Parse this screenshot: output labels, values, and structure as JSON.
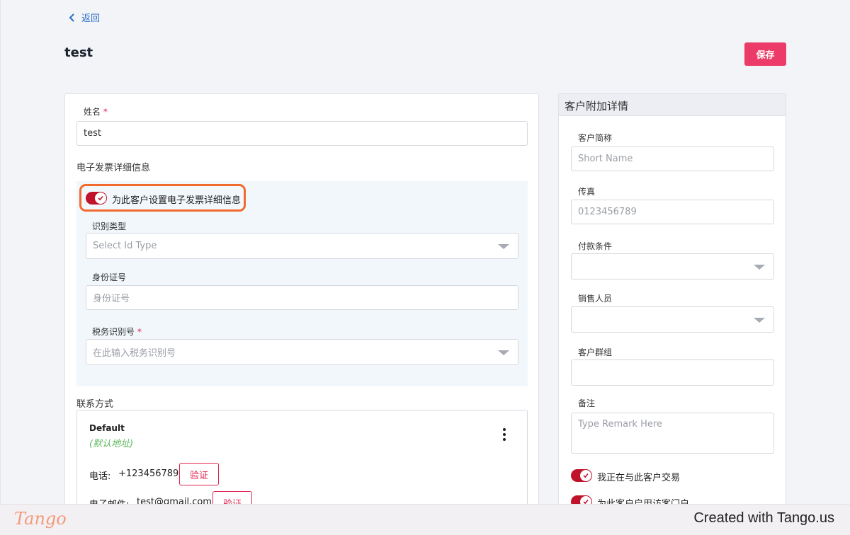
{
  "nav": {
    "back_label": "返回"
  },
  "page": {
    "title": "test",
    "save_label": "保存"
  },
  "left": {
    "name_label": "姓名",
    "required_mark": "*",
    "name_value": "test",
    "einvoice_section": "电子发票详细信息",
    "einvoice_toggle_label": "为此客户设置电子发票详细信息",
    "id_type_label": "识别类型",
    "id_type_placeholder": "Select Id Type",
    "id_number_label": "身份证号",
    "id_number_placeholder": "身份证号",
    "tax_id_label": "税务识别号",
    "tax_id_placeholder": "在此输入税务识别号",
    "contact_section": "联系方式",
    "contact": {
      "name": "Default",
      "default_tag": "(默认地址)",
      "phone_label": "电话:",
      "phone_value": "+123456789",
      "email_label": "电子邮件:",
      "email_value": "test@gmail.com",
      "verify_label": "验证"
    }
  },
  "right": {
    "header": "客户附加详情",
    "short_name_label": "客户简称",
    "short_name_placeholder": "Short Name",
    "fax_label": "传真",
    "fax_placeholder": "0123456789",
    "payment_terms_label": "付款条件",
    "salesperson_label": "销售人员",
    "customer_group_label": "客户群组",
    "remark_label": "备注",
    "remark_placeholder": "Type Remark Here",
    "trading_toggle_label": "我正在与此客户交易",
    "portal_toggle_label": "为此客户启用访客门户"
  },
  "footer": {
    "logo": "Tango",
    "credit": "Created with Tango.us"
  },
  "colors": {
    "accent": "#ec3b68",
    "toggle_on": "#c0132b",
    "highlight": "#f26a2d",
    "link": "#2a6fc4"
  }
}
